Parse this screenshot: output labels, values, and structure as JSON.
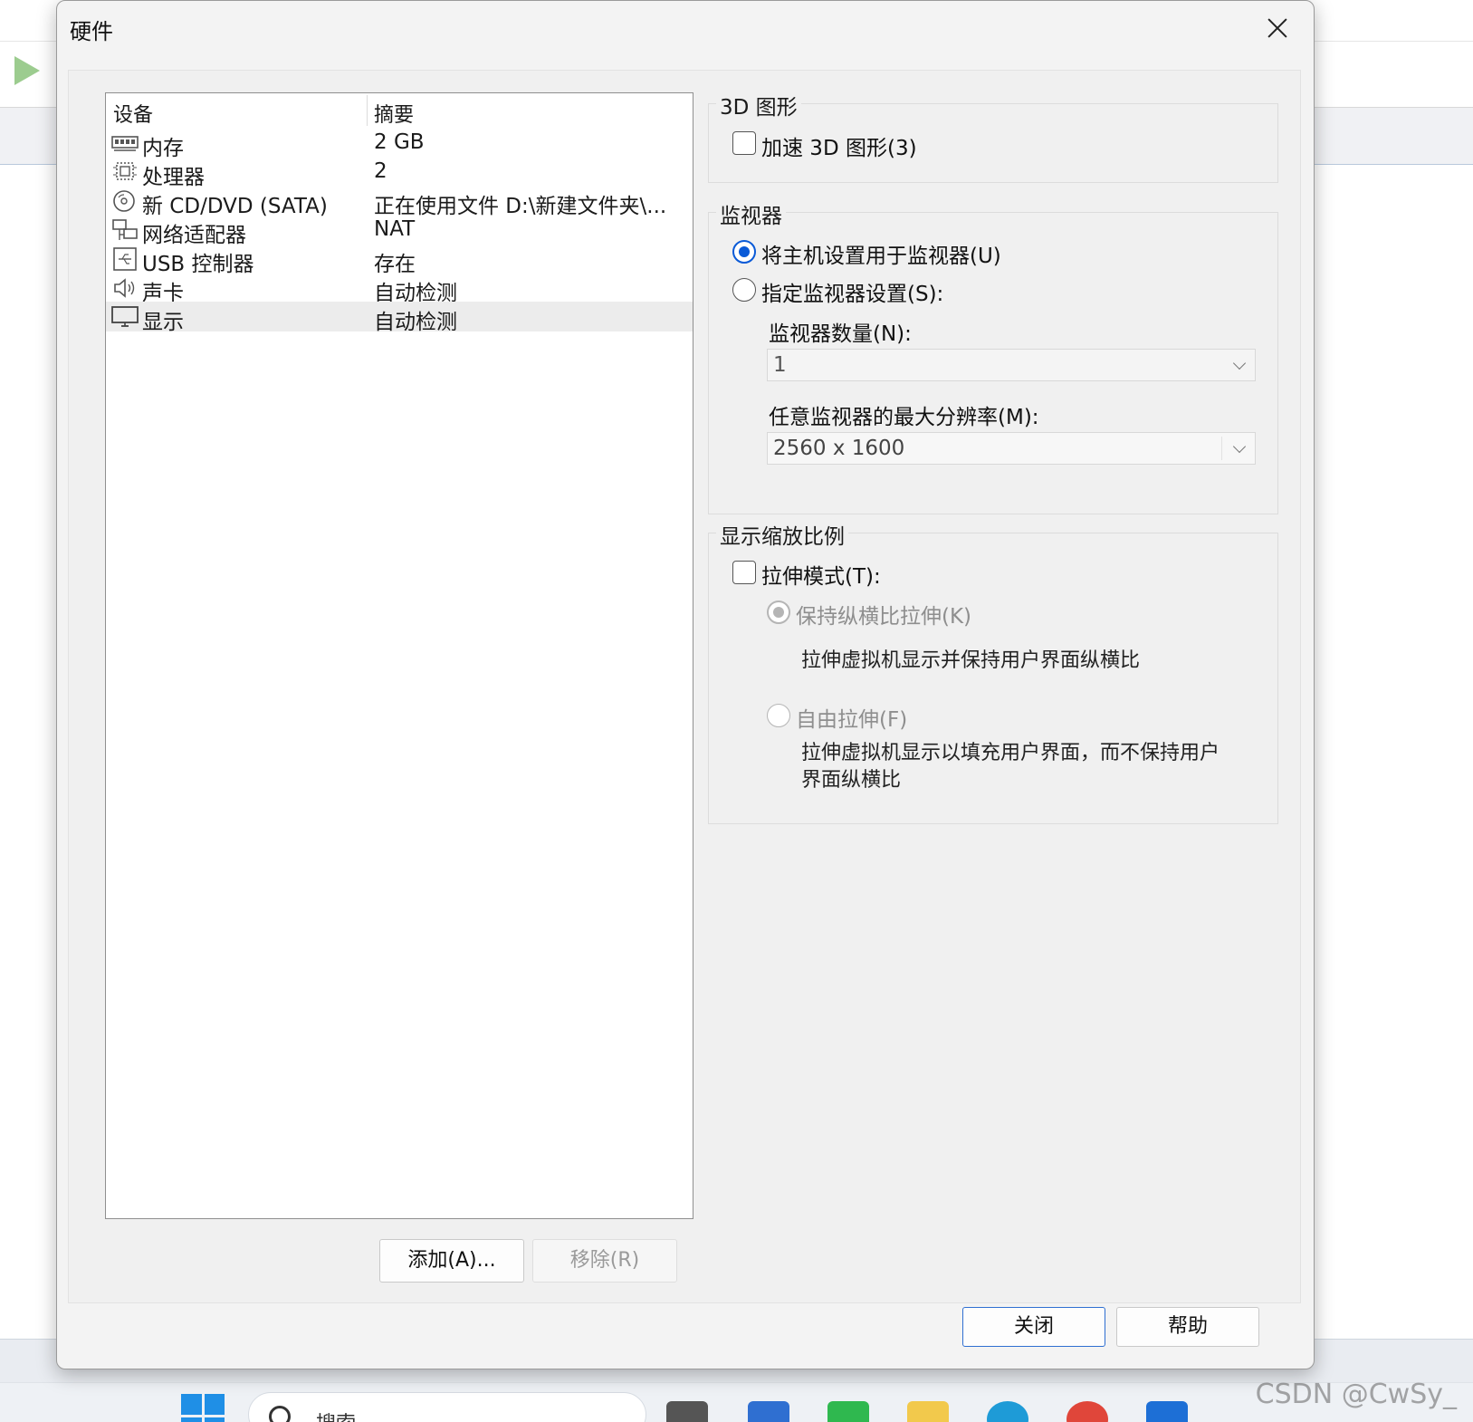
{
  "dialog": {
    "title": "硬件"
  },
  "device_list": {
    "headers": {
      "device": "设备",
      "summary": "摘要"
    },
    "rows": [
      {
        "icon": "memory-icon",
        "name": "内存",
        "summary": "2 GB"
      },
      {
        "icon": "processor-icon",
        "name": "处理器",
        "summary": "2"
      },
      {
        "icon": "cd-dvd-icon",
        "name": "新 CD/DVD (SATA)",
        "summary": "正在使用文件 D:\\新建文件夹\\..."
      },
      {
        "icon": "network-adapter-icon",
        "name": "网络适配器",
        "summary": "NAT"
      },
      {
        "icon": "usb-icon",
        "name": "USB 控制器",
        "summary": "存在"
      },
      {
        "icon": "sound-card-icon",
        "name": "声卡",
        "summary": "自动检测"
      },
      {
        "icon": "display-icon",
        "name": "显示",
        "summary": "自动检测",
        "selected": true
      }
    ]
  },
  "list_buttons": {
    "add": "添加(A)...",
    "remove": "移除(R)"
  },
  "graphics_3d": {
    "title": "3D 图形",
    "accelerate_label": "加速 3D 图形(3)",
    "accelerate_checked": false
  },
  "monitor": {
    "title": "监视器",
    "use_host_label": "将主机设置用于监视器(U)",
    "specify_label": "指定监视器设置(S):",
    "selected": "use_host",
    "count_label": "监视器数量(N):",
    "count_value": "1",
    "max_res_label": "任意监视器的最大分辨率(M):",
    "max_res_value": "2560 x 1600"
  },
  "scaling": {
    "title": "显示缩放比例",
    "stretch_label": "拉伸模式(T):",
    "stretch_checked": false,
    "keep_aspect_label": "保持纵横比拉伸(K)",
    "keep_aspect_desc": "拉伸虚拟机显示并保持用户界面纵横比",
    "free_label": "自由拉伸(F)",
    "free_desc": "拉伸虚拟机显示以填充用户界面，而不保持用户界面纵横比"
  },
  "footer": {
    "close": "关闭",
    "help": "帮助"
  },
  "taskbar": {
    "search_placeholder": "搜索"
  },
  "watermark": "CSDN @CwSy_",
  "colors": {
    "accent": "#0a5ad7",
    "play": "#9ccc8f",
    "start": "#1f8fe6"
  }
}
